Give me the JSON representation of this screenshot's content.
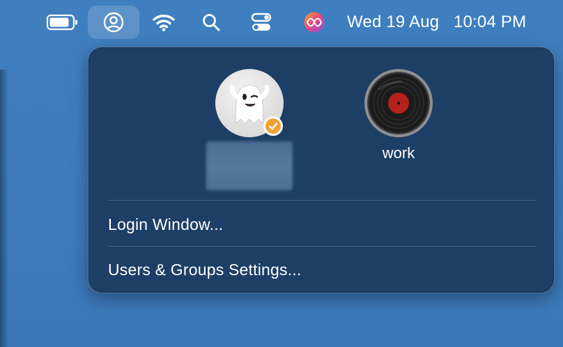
{
  "menubar": {
    "items": [
      {
        "icon": "battery-icon"
      },
      {
        "icon": "user-icon",
        "active": true
      },
      {
        "icon": "wifi-icon"
      },
      {
        "icon": "search-icon"
      },
      {
        "icon": "control-center-icon"
      },
      {
        "icon": "siri-icon"
      }
    ],
    "date": "Wed 19 Aug",
    "time": "10:04 PM"
  },
  "fast_user_switching": {
    "users": [
      {
        "avatar": "ghost-avatar",
        "name": "",
        "current": true
      },
      {
        "avatar": "vinyl-record-avatar",
        "name": "work",
        "current": false
      }
    ],
    "menu": [
      {
        "label": "Login Window..."
      },
      {
        "label": "Users & Groups Settings..."
      }
    ]
  },
  "colors": {
    "desktop": "#3f7fbf",
    "panel": "#1d3f66",
    "check_badge": "#f1a233",
    "text": "#ffffff"
  }
}
